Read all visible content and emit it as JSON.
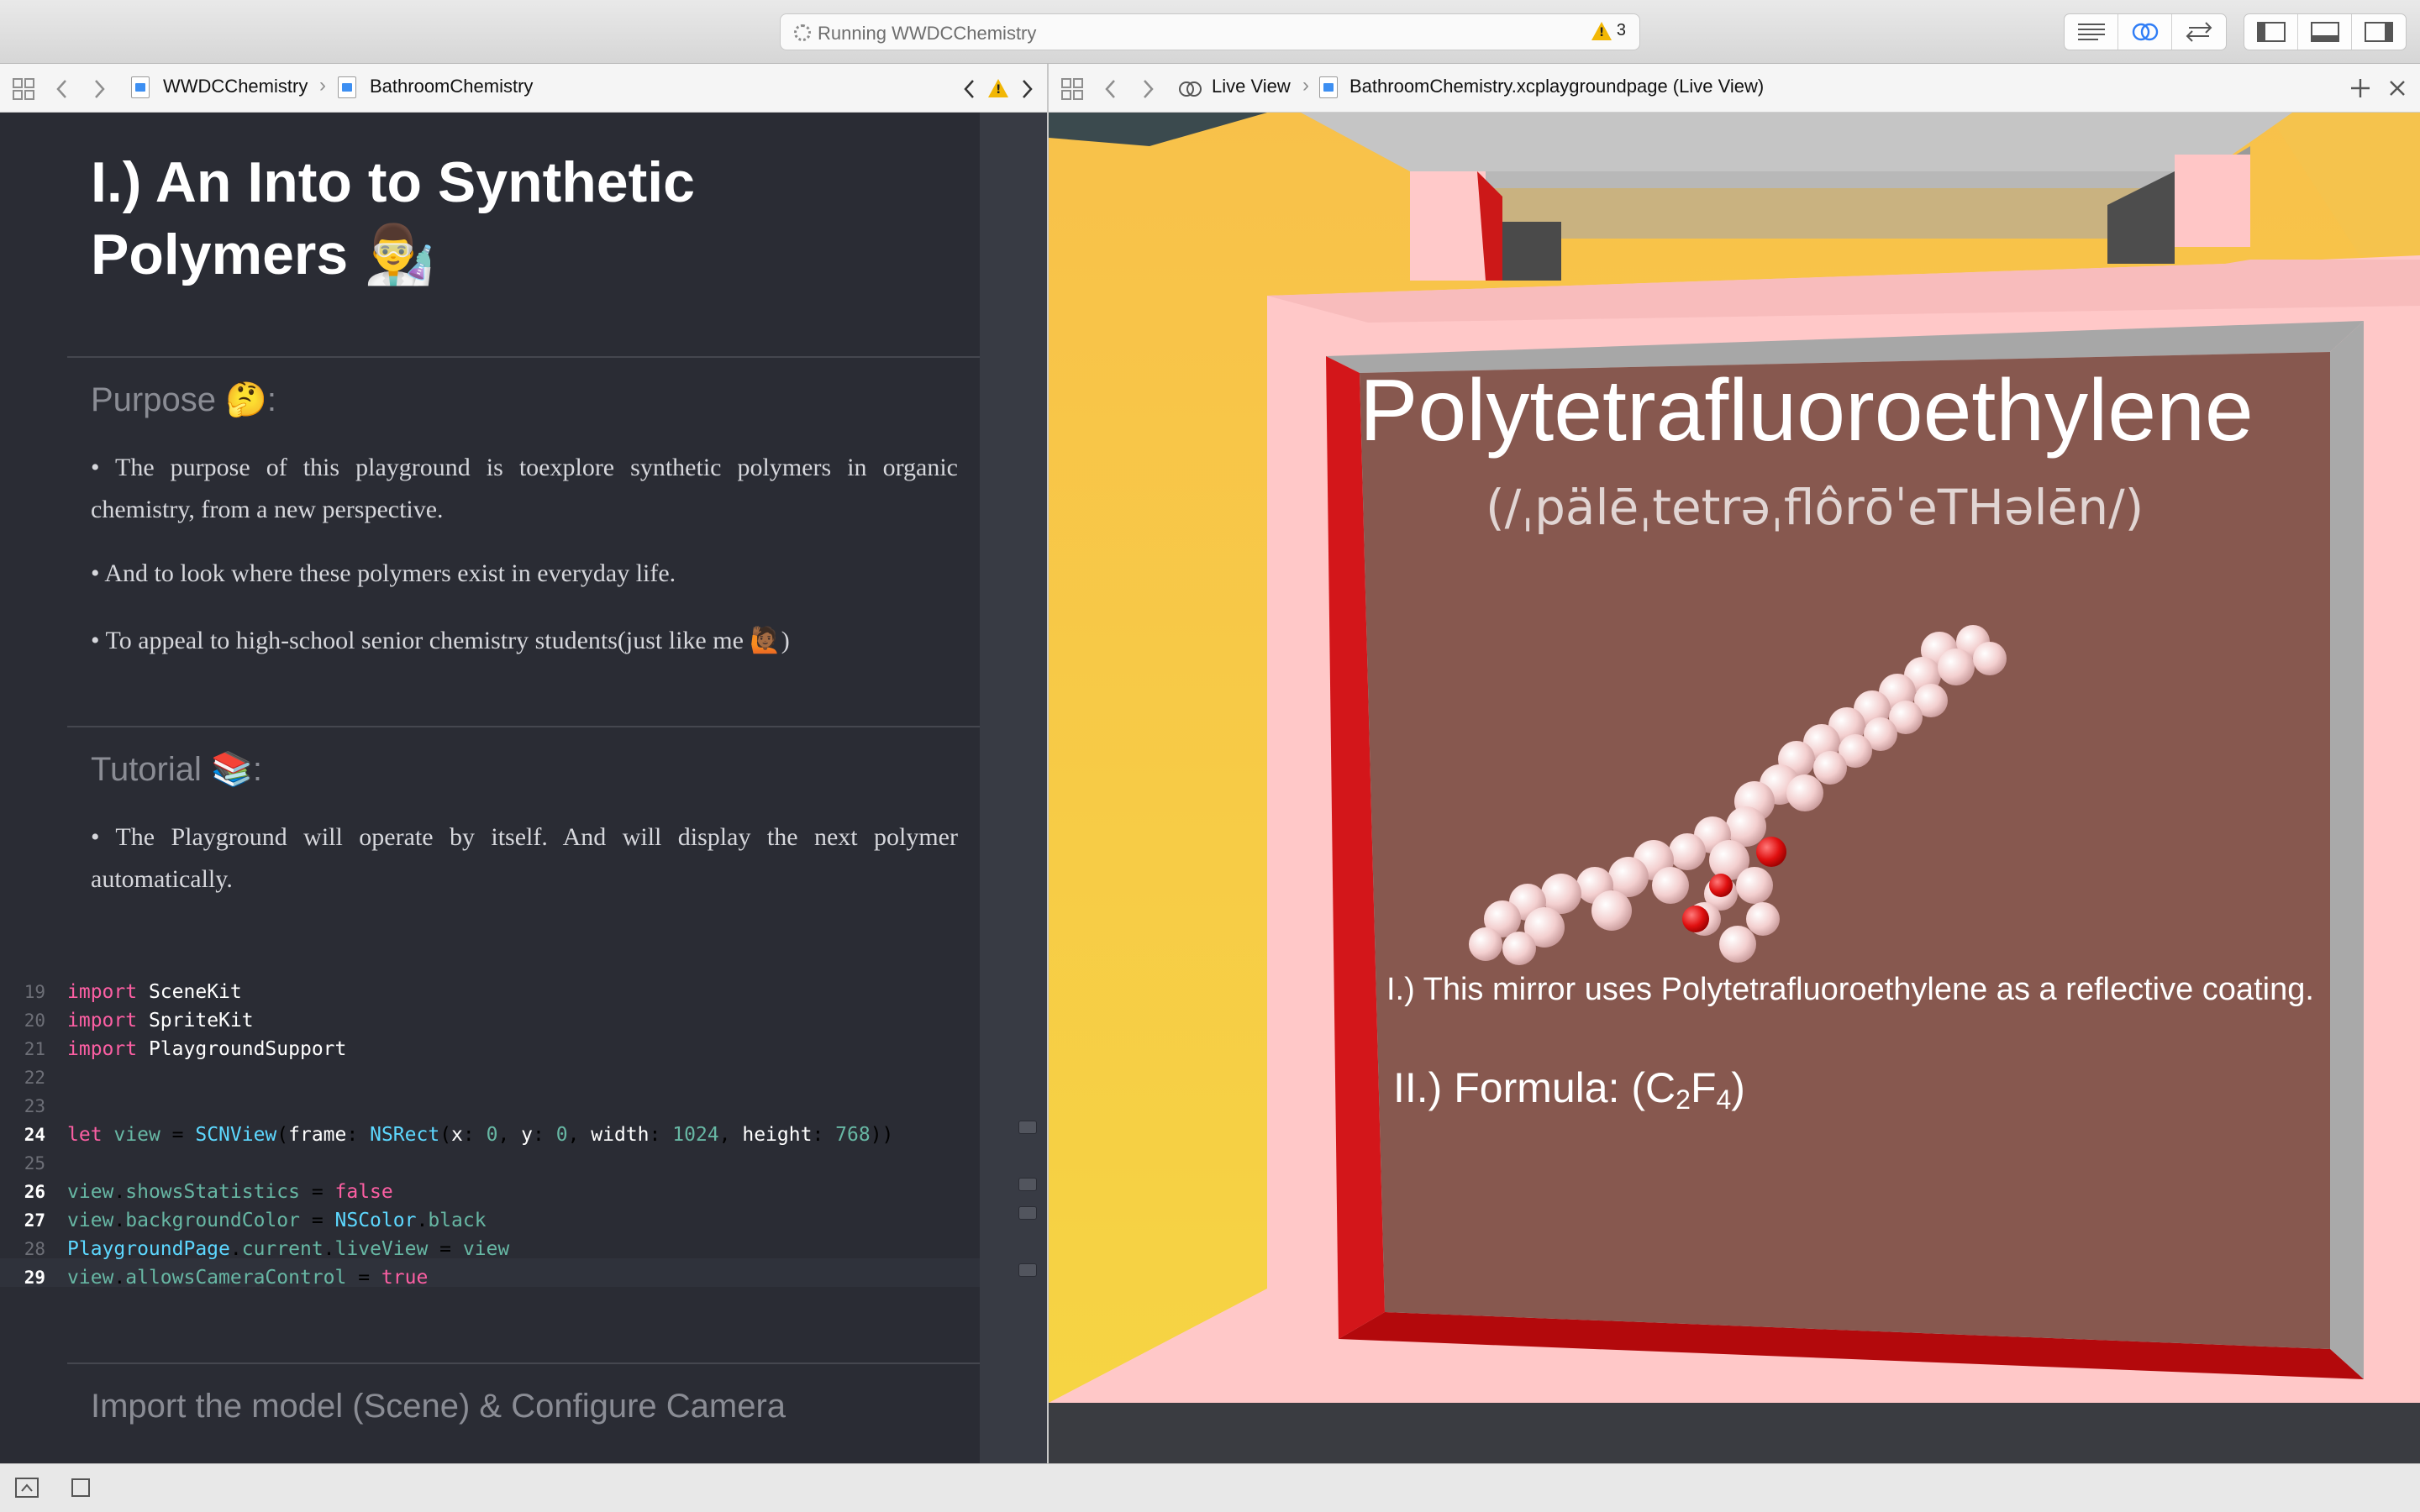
{
  "activity": {
    "status": "Running WWDCChemistry",
    "warnings": "3"
  },
  "nav_left": {
    "project": "WWDCChemistry",
    "page": "BathroomChemistry"
  },
  "nav_right": {
    "mode": "Live View",
    "file": "BathroomChemistry.xcplaygroundpage (Live View)"
  },
  "doc": {
    "title": "I.) An Into to Synthetic Polymers 👨‍🔬",
    "purpose": {
      "heading": "Purpose 🤔:",
      "bullets": [
        "• The purpose of this playground is toexplore synthetic polymers in organic chemistry, from a new perspective.",
        "• And to look where these polymers exist in everyday life.",
        "• To appeal to high-school senior chemistry students(just like me 🙋🏾)"
      ]
    },
    "tutorial": {
      "heading": "Tutorial 📚:",
      "bullets": [
        "• The Playground will operate by itself. And will display the next polymer automatically."
      ]
    },
    "next_heading": "Import the model (Scene) & Configure Camera"
  },
  "code": [
    {
      "n": "19",
      "t": "import SceneKit"
    },
    {
      "n": "20",
      "t": "import SpriteKit"
    },
    {
      "n": "21",
      "t": "import PlaygroundSupport"
    },
    {
      "n": "22",
      "t": ""
    },
    {
      "n": "23",
      "t": ""
    },
    {
      "n": "24",
      "t": "let view = SCNView(frame: NSRect(x: 0, y: 0, width: 1024, height: 768))"
    },
    {
      "n": "25",
      "t": ""
    },
    {
      "n": "26",
      "t": "view.showsStatistics = false"
    },
    {
      "n": "27",
      "t": "view.backgroundColor = NSColor.black"
    },
    {
      "n": "28",
      "t": "PlaygroundPage.current.liveView = view"
    },
    {
      "n": "29",
      "t": "view.allowsCameraControl = true"
    }
  ],
  "live": {
    "name": "Polytetrafluoroethylene",
    "pronunciation": "(/ˌpälēˌtetrəˌflôrōˈeTHəlēn/)",
    "fact1": "I.) This mirror uses Polytetrafluoroethylene as a reflective coating.",
    "fact2_prefix": "II.) Formula: (C",
    "fact2_sub1": "2",
    "fact2_mid": "F",
    "fact2_sub2": "4",
    "fact2_suffix": ")"
  }
}
